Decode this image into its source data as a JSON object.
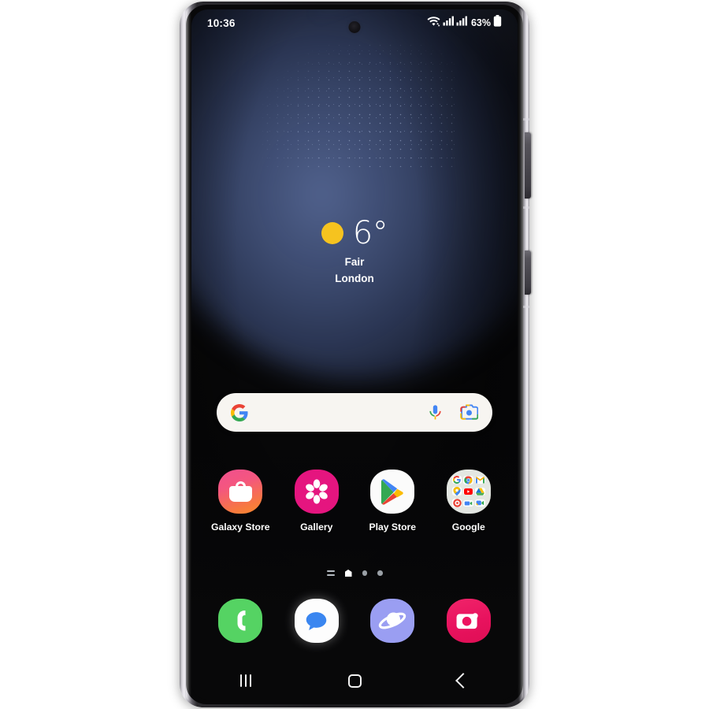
{
  "device": {
    "name": "Samsung Galaxy smartphone",
    "frame_color": "#1a191c",
    "side_buttons": [
      "volume-rocker",
      "power-button"
    ]
  },
  "status_bar": {
    "time": "10:36",
    "battery_percent": "63%",
    "icons": [
      "wifi-icon",
      "signal-bars-icon",
      "signal-bars-icon",
      "battery-icon"
    ],
    "camera": "punch-hole-camera"
  },
  "weather_widget": {
    "condition_icon": "sun-icon",
    "temperature": "6°",
    "condition": "Fair",
    "location": "London",
    "sun_color": "#f6c31f"
  },
  "search": {
    "placeholder": "",
    "value": "",
    "logo": "google-g-icon",
    "mic": "microphone-icon",
    "lens": "google-lens-camera-icon",
    "background": "#f7f5f1"
  },
  "apps": [
    {
      "label": "Galaxy Store",
      "icon": "galaxy-store-icon",
      "color": "#f4567f"
    },
    {
      "label": "Gallery",
      "icon": "gallery-flower-icon",
      "color": "#e5157f"
    },
    {
      "label": "Play Store",
      "icon": "play-store-icon",
      "color": "#fbfbfb"
    },
    {
      "label": "Google",
      "icon": "google-folder-icon",
      "color": "#e4e7e2"
    }
  ],
  "google_folder": {
    "apps": [
      "google-search-icon",
      "chrome-icon",
      "gmail-icon",
      "maps-icon",
      "youtube-icon",
      "drive-icon",
      "photos-icon",
      "meet-icon",
      "duo-icon"
    ]
  },
  "page_indicator": {
    "items": [
      "apps-list-icon",
      "home-page-active",
      "page-dot",
      "page-dot"
    ],
    "active_index": 1,
    "active_color": "#ffffff",
    "inactive_color": "#9aa0a6"
  },
  "dock": [
    {
      "label": "Phone",
      "icon": "phone-icon",
      "color": "#55d363"
    },
    {
      "label": "Messages",
      "icon": "messages-icon",
      "color": "#fdfdfd"
    },
    {
      "label": "Internet",
      "icon": "samsung-internet-icon",
      "color": "#9a9ef2"
    },
    {
      "label": "Camera",
      "icon": "camera-icon",
      "color": "#e8125e"
    }
  ],
  "nav_bar": {
    "recents": "recents-icon",
    "home": "home-icon",
    "back": "back-icon"
  }
}
